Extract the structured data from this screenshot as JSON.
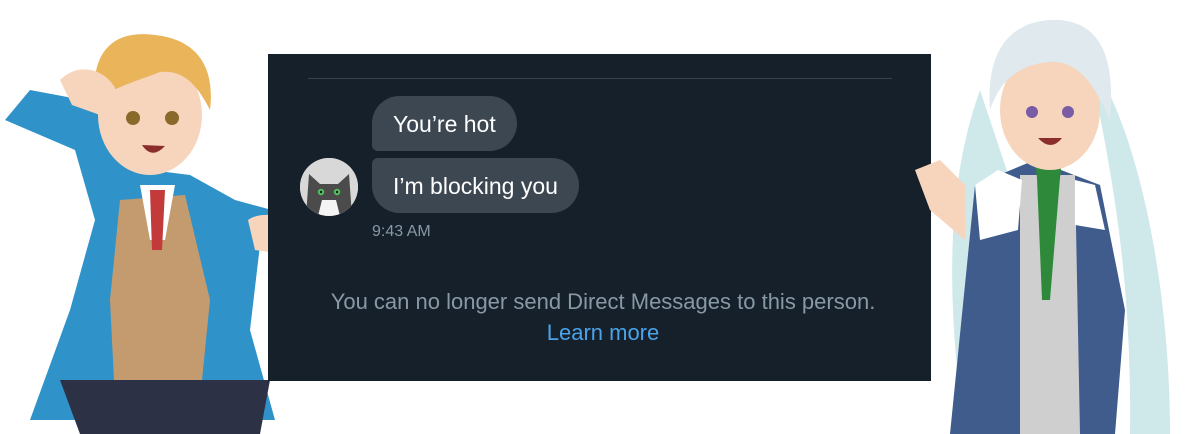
{
  "conversation": {
    "messages": [
      {
        "text": "You’re hot"
      },
      {
        "text": "I’m blocking you"
      }
    ],
    "timestamp": "9:43 AM",
    "notice": {
      "text": "You can no longer send Direct Messages to this person.",
      "link": "Learn more"
    }
  },
  "colors": {
    "panel_background": "#15202b",
    "bubble": "#3d4752",
    "muted_text": "#8899a6",
    "link": "#4aa3e8"
  },
  "decorations": {
    "left_character": "anime-boy-blazer",
    "right_character": "anime-long-hair-vest",
    "avatar": "gray-cat-avatar"
  }
}
